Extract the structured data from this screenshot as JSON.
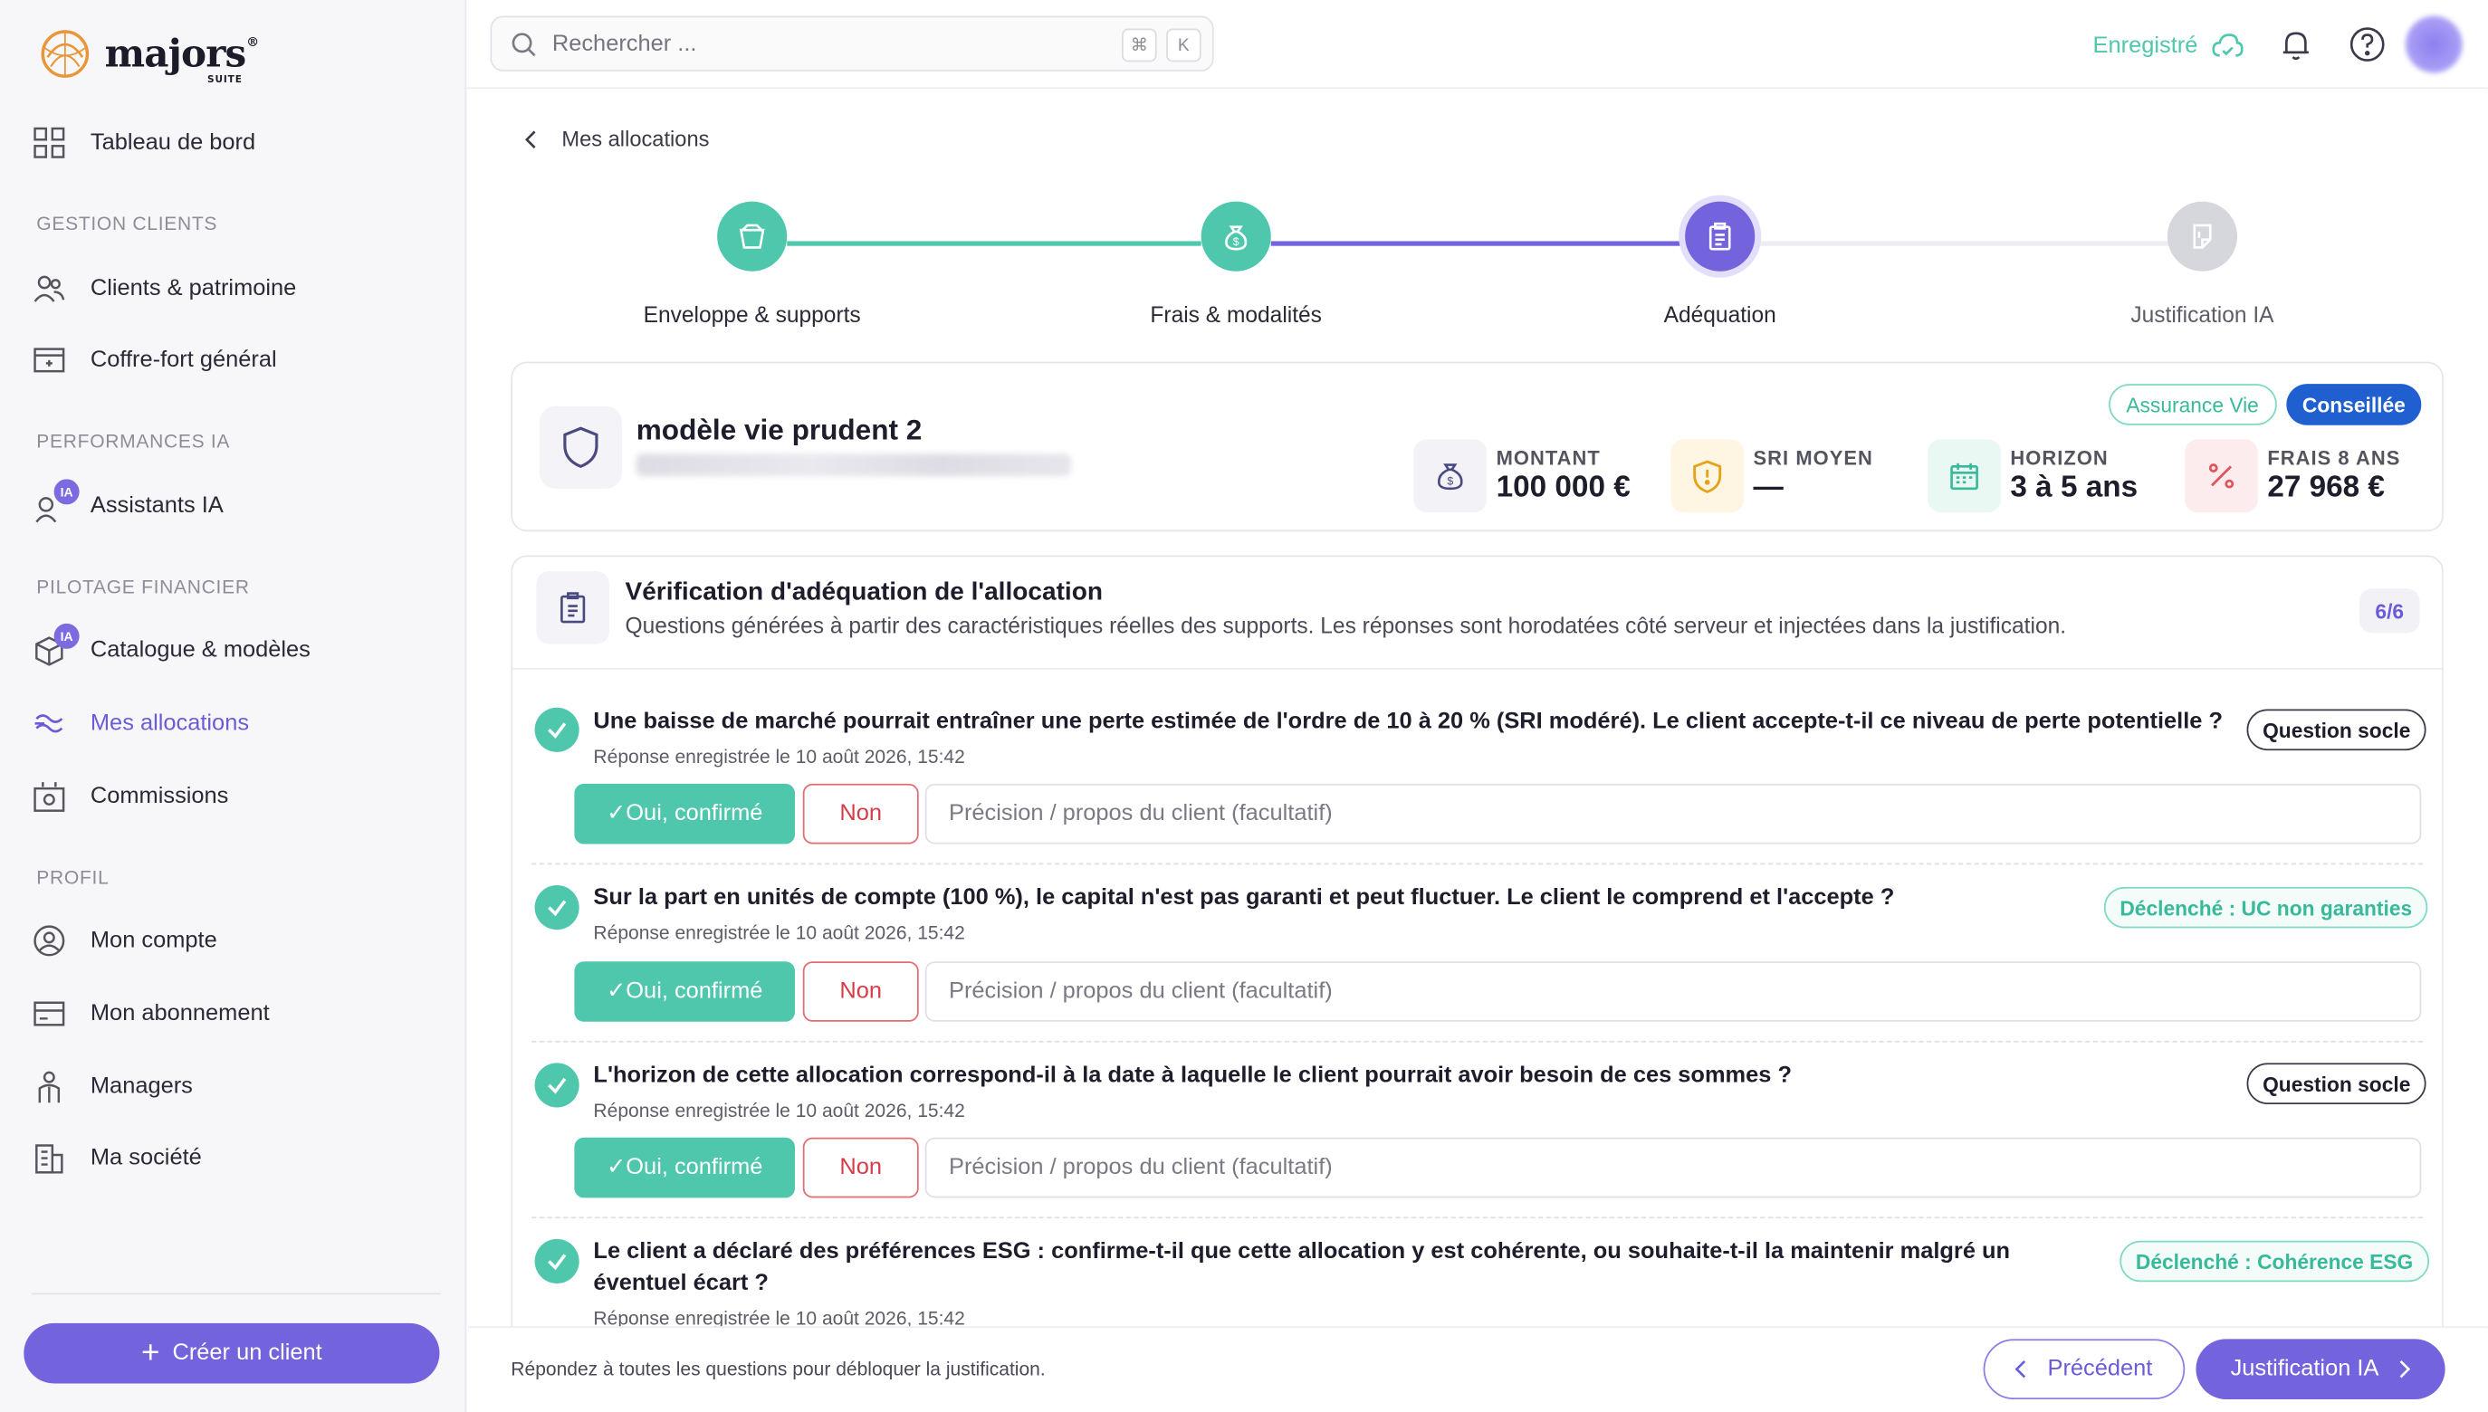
{
  "brand": {
    "name": "majors",
    "suffix": "SUITE",
    "reg": "®"
  },
  "sidebar": {
    "dashboard": "Tableau de bord",
    "sections": {
      "clients": "GESTION CLIENTS",
      "perf": "PERFORMANCES IA",
      "pilotage": "PILOTAGE FINANCIER",
      "profil": "PROFIL"
    },
    "items": {
      "clients": "Clients & patrimoine",
      "vault": "Coffre-fort général",
      "assistants": "Assistants IA",
      "catalog": "Catalogue & modèles",
      "allocations": "Mes allocations",
      "commissions": "Commissions",
      "account": "Mon compte",
      "subscription": "Mon abonnement",
      "managers": "Managers",
      "company": "Ma société"
    },
    "ia_badge": "IA",
    "create_button": "Créer un client"
  },
  "topbar": {
    "search_placeholder": "Rechercher ...",
    "kbd_cmd": "⌘",
    "kbd_k": "K",
    "saved_label": "Enregistré"
  },
  "breadcrumb": {
    "back_label": "Mes allocations"
  },
  "stepper": {
    "steps": [
      "Enveloppe & supports",
      "Frais & modalités",
      "Adéquation",
      "Justification IA"
    ]
  },
  "model": {
    "title": "modèle vie prudent 2",
    "tag_product": "Assurance Vie",
    "tag_status": "Conseillée",
    "stats": [
      {
        "label": "MONTANT",
        "value": "100 000 €"
      },
      {
        "label": "SRI MOYEN",
        "value": "—"
      },
      {
        "label": "HORIZON",
        "value": "3 à 5 ans"
      },
      {
        "label": "FRAIS 8 ANS",
        "value": "27 968 €"
      }
    ]
  },
  "verification": {
    "title": "Vérification d'adéquation de l'allocation",
    "description": "Questions générées à partir des caractéristiques réelles des supports. Les réponses sont horodatées côté serveur et injectées dans la justification.",
    "count": "6/6",
    "yes_label": "✓Oui, confirmé",
    "no_label": "Non",
    "precision_placeholder": "Précision / propos du client (facultatif)",
    "questions": [
      {
        "text": "Une baisse de marché pourrait entraîner une perte estimée de l'ordre de 10 à 20 % (SRI modéré). Le client accepte-t-il ce niveau de perte potentielle ?",
        "meta": "Réponse enregistrée le 10 août 2026, 15:42",
        "tag": "Question socle"
      },
      {
        "text": "Sur la part en unités de compte (100 %), le capital n'est pas garanti et peut fluctuer. Le client le comprend et l'accepte ?",
        "meta": "Réponse enregistrée le 10 août 2026, 15:42",
        "tag": "Déclenché : UC non garanties"
      },
      {
        "text": "L'horizon de cette allocation correspond-il à la date à laquelle le client pourrait avoir besoin de ces sommes ?",
        "meta": "Réponse enregistrée le 10 août 2026, 15:42",
        "tag": "Question socle"
      },
      {
        "text": "Le client a déclaré des préférences ESG : confirme-t-il que cette allocation y est cohérente, ou souhaite-t-il la maintenir malgré un éventuel écart ?",
        "meta": "Réponse enregistrée le 10 août 2026, 15:42",
        "tag": "Déclenché : Cohérence ESG"
      }
    ]
  },
  "footer": {
    "hint": "Répondez à toutes les questions pour débloquer la justification.",
    "prev_label": "Précédent",
    "next_label": "Justification IA"
  },
  "colors": {
    "accent": "#7363dc",
    "teal": "#4fc7ad",
    "danger": "#d63c47"
  }
}
